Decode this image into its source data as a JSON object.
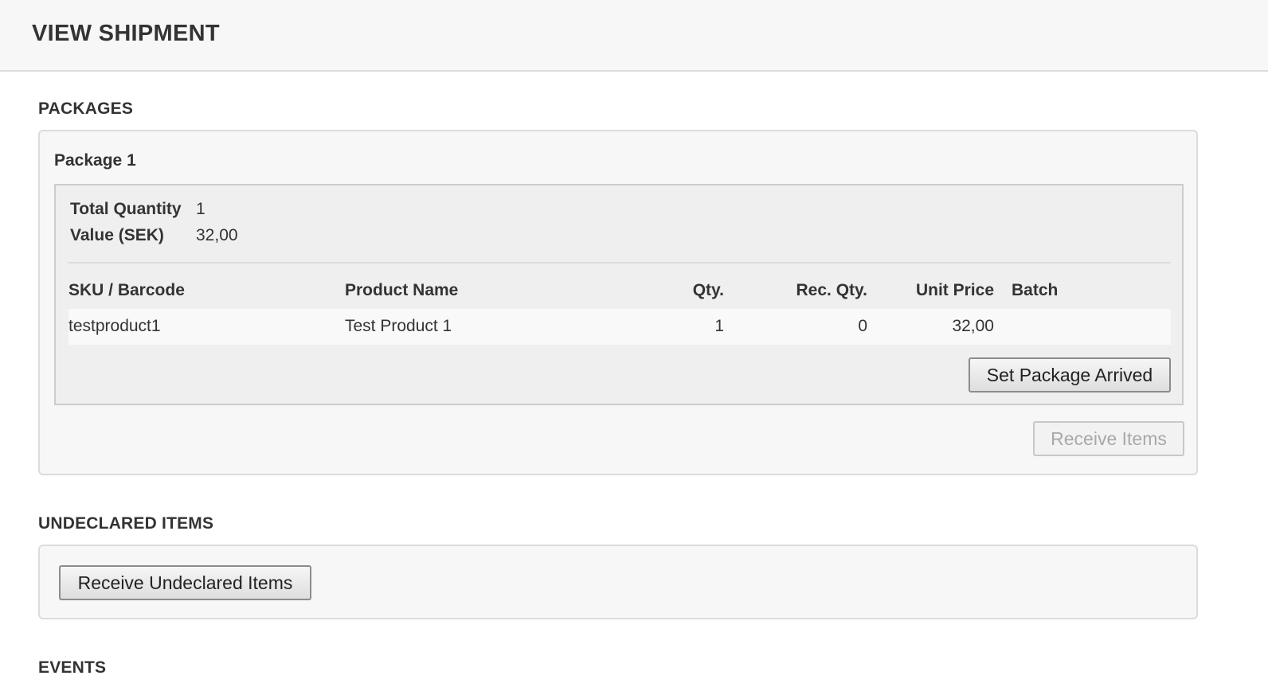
{
  "header": {
    "title": "VIEW SHIPMENT"
  },
  "packages": {
    "section_title": "PACKAGES",
    "items": [
      {
        "name": "Package 1",
        "summary": {
          "total_quantity_label": "Total Quantity",
          "total_quantity_value": "1",
          "value_label": "Value (SEK)",
          "value_value": "32,00"
        },
        "table": {
          "headers": {
            "sku": "SKU / Barcode",
            "product_name": "Product Name",
            "qty": "Qty.",
            "rec_qty": "Rec. Qty.",
            "unit_price": "Unit Price",
            "batch": "Batch"
          },
          "rows": [
            {
              "sku": "testproduct1",
              "product_name": "Test Product 1",
              "qty": "1",
              "rec_qty": "0",
              "unit_price": "32,00",
              "batch": ""
            }
          ]
        },
        "set_arrived_label": "Set Package Arrived"
      }
    ],
    "receive_items_label": "Receive Items"
  },
  "undeclared": {
    "section_title": "UNDECLARED ITEMS",
    "button_label": "Receive Undeclared Items"
  },
  "events": {
    "section_title": "EVENTS"
  }
}
